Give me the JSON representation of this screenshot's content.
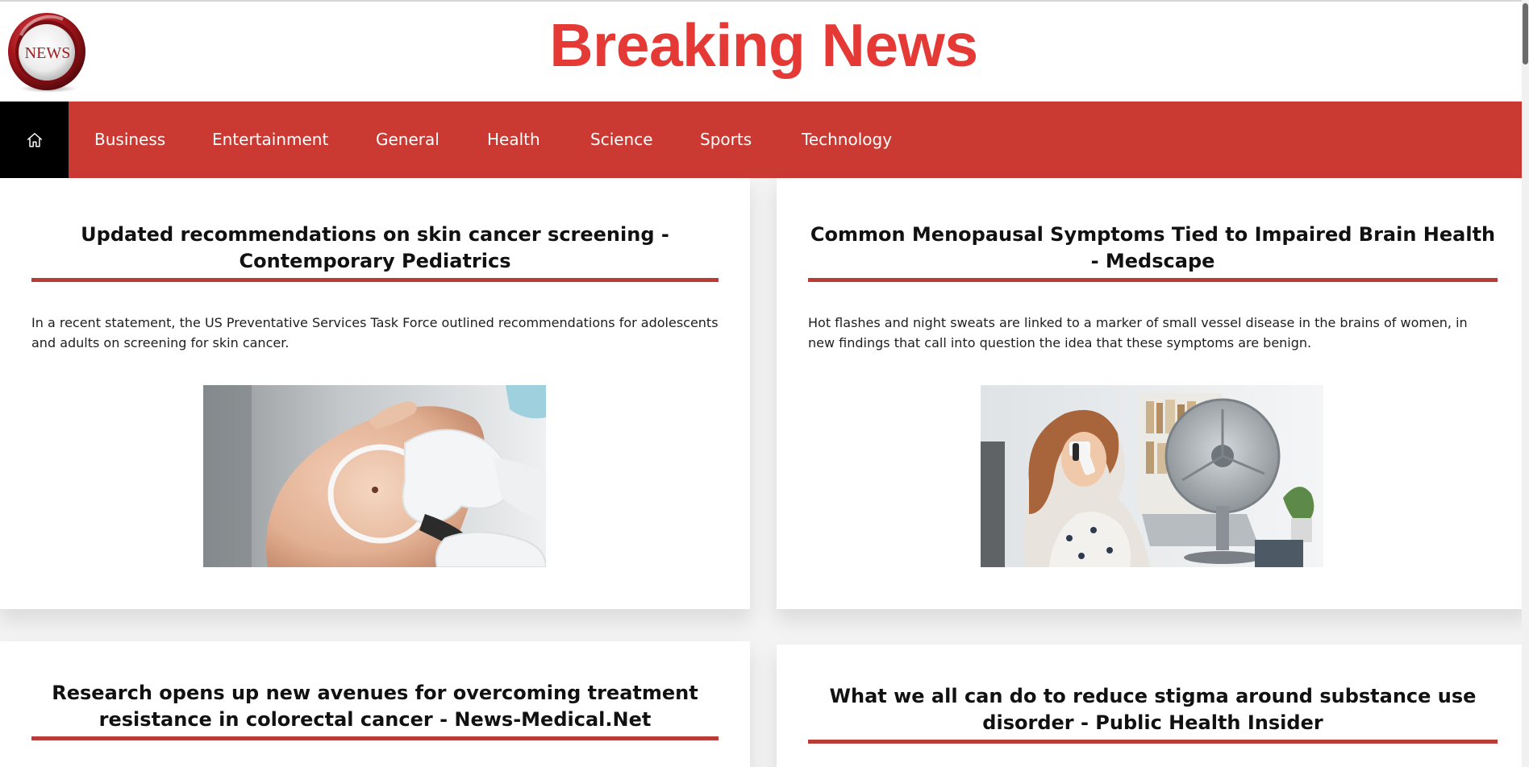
{
  "header": {
    "title": "Breaking News",
    "logo_text": "NEWS"
  },
  "nav": {
    "home_icon": "home-icon",
    "items": [
      {
        "label": "Business"
      },
      {
        "label": "Entertainment"
      },
      {
        "label": "General"
      },
      {
        "label": "Health"
      },
      {
        "label": "Science"
      },
      {
        "label": "Sports"
      },
      {
        "label": "Technology"
      }
    ]
  },
  "articles": [
    {
      "title": "Updated recommendations on skin cancer screening - Contemporary Pediatrics",
      "description": "In a recent statement, the US Preventative Services Task Force outlined recommendations for adolescents and adults on screening for skin cancer."
    },
    {
      "title": "Common Menopausal Symptoms Tied to Impaired Brain Health - Medscape",
      "description": "Hot flashes and night sweats are linked to a marker of small vessel disease in the brains of women, in new findings that call into question the idea that these symptoms are benign."
    },
    {
      "title": "Research opens up new avenues for overcoming treatment resistance in colorectal cancer - News-Medical.Net"
    },
    {
      "title": "What we all can do to reduce stigma around substance use disorder - Public Health Insider"
    }
  ],
  "colors": {
    "brand_red": "#e53935",
    "nav_bg": "#ca3a33",
    "rule_red": "#b93c36",
    "home_bg": "#000000"
  }
}
